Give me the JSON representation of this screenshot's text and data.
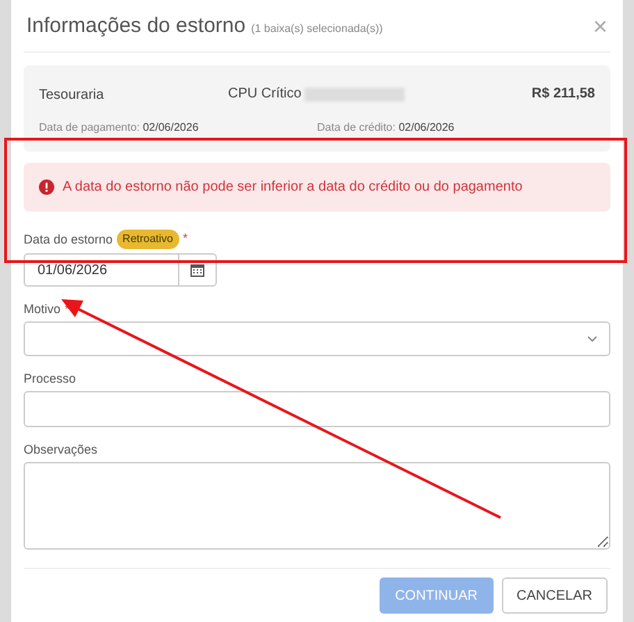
{
  "dialog": {
    "title": "Informações do estorno",
    "subtitle": "(1 baixa(s) selecionada(s))",
    "close": "×"
  },
  "summary": {
    "account": "Tesouraria",
    "description": "CPU Crítico",
    "redacted": true,
    "amount": "R$ 211,58",
    "dates": [
      {
        "label": "Data de pagamento:",
        "value": "02/06/2026"
      },
      {
        "label": "Data de crédito:",
        "value": "02/06/2026"
      }
    ]
  },
  "alert": {
    "message": "A data do estorno não pode ser inferior a data do crédito ou do pagamento"
  },
  "fields": [
    {
      "kind": "date",
      "label": "Data do estorno",
      "badge": "Retroativo",
      "required_mark": "*",
      "value": "01/06/2026"
    },
    {
      "kind": "select",
      "label": "Motivo",
      "required_mark": "*"
    },
    {
      "kind": "text",
      "label": "Processo"
    },
    {
      "kind": "textarea",
      "label": "Observações"
    }
  ],
  "buttons": [
    {
      "label": "CONTINUAR",
      "kind": "primary",
      "disabled": true
    },
    {
      "label": "CANCELAR",
      "kind": "secondary",
      "disabled": false
    }
  ],
  "annotation": {
    "highlight": true,
    "arrow": true
  }
}
